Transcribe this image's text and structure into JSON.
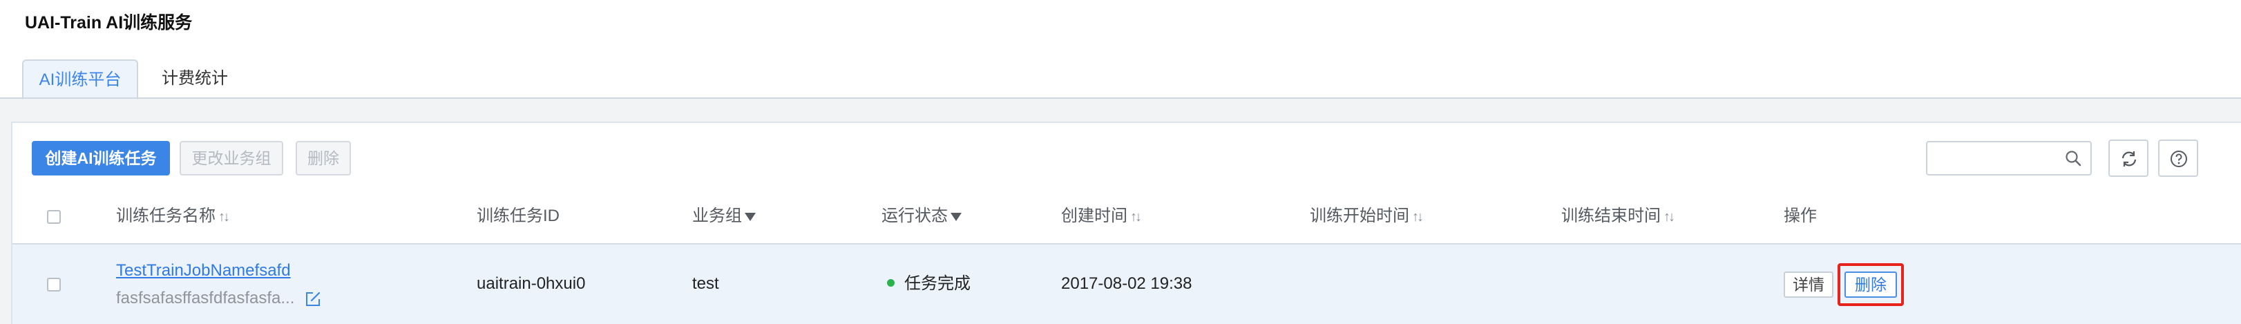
{
  "app": {
    "title": "UAI-Train AI训练服务"
  },
  "tabs": [
    {
      "label": "AI训练平台",
      "active": true
    },
    {
      "label": "计费统计",
      "active": false
    }
  ],
  "toolbar": {
    "create_label": "创建AI训练任务",
    "change_group_label": "更改业务组",
    "delete_label": "删除",
    "search": {
      "value": "",
      "placeholder": ""
    }
  },
  "table": {
    "columns": [
      {
        "label": "训练任务名称",
        "indicator": "sort"
      },
      {
        "label": "训练任务ID",
        "indicator": ""
      },
      {
        "label": "业务组",
        "indicator": "filter"
      },
      {
        "label": "运行状态",
        "indicator": "filter"
      },
      {
        "label": "创建时间",
        "indicator": "sort"
      },
      {
        "label": "训练开始时间",
        "indicator": "sort"
      },
      {
        "label": "训练结束时间",
        "indicator": "sort"
      },
      {
        "label": "操作",
        "indicator": ""
      }
    ],
    "sort_glyph": "↑↓",
    "rows": [
      {
        "name": "TestTrainJobNamefsafd",
        "description": "fasfsafasffasfdfasfasfa...",
        "id": "uaitrain-0hxui0",
        "group": "test",
        "status": "任务完成",
        "created": "2017-08-02 19:38",
        "start": "",
        "end": "",
        "actions": {
          "detail": "详情",
          "delete": "删除"
        }
      }
    ]
  },
  "colors": {
    "accent": "#3a85e6",
    "status_success": "#2bb24c",
    "highlight": "#e8231c",
    "row_bg": "#edf3fb"
  },
  "icons": [
    "search-icon",
    "refresh-icon",
    "help-icon",
    "edit-icon",
    "sort-icon",
    "filter-icon"
  ]
}
